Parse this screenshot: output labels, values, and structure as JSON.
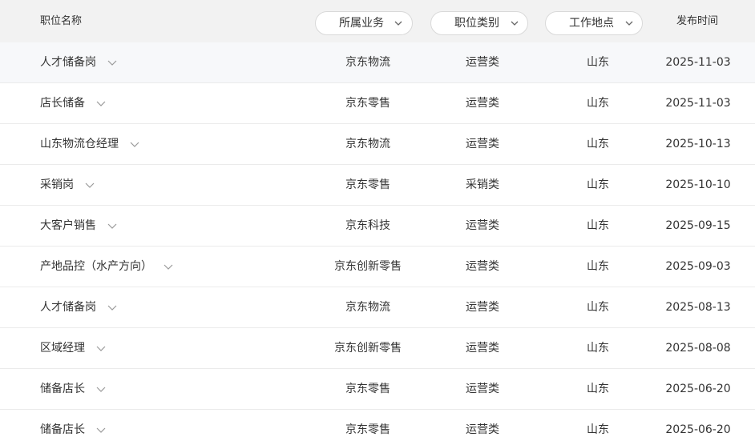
{
  "header": {
    "col_title": "职位名称",
    "filters": [
      {
        "label": "所属业务",
        "icon": "chevron-down-icon"
      },
      {
        "label": "职位类别",
        "icon": "chevron-down-icon"
      },
      {
        "label": "工作地点",
        "icon": "chevron-down-icon"
      }
    ],
    "col_date": "发布时间"
  },
  "rows": [
    {
      "title": "人才储备岗",
      "business": "京东物流",
      "category": "运营类",
      "location": "山东",
      "date": "2025-11-03",
      "highlighted": true
    },
    {
      "title": "店长储备",
      "business": "京东零售",
      "category": "运营类",
      "location": "山东",
      "date": "2025-11-03"
    },
    {
      "title": "山东物流仓经理",
      "business": "京东物流",
      "category": "运营类",
      "location": "山东",
      "date": "2025-10-13"
    },
    {
      "title": "采销岗",
      "business": "京东零售",
      "category": "采销类",
      "location": "山东",
      "date": "2025-10-10"
    },
    {
      "title": "大客户销售",
      "business": "京东科技",
      "category": "运营类",
      "location": "山东",
      "date": "2025-09-15"
    },
    {
      "title": "产地品控（水产方向）",
      "business": "京东创新零售",
      "category": "运营类",
      "location": "山东",
      "date": "2025-09-03"
    },
    {
      "title": "人才储备岗",
      "business": "京东物流",
      "category": "运营类",
      "location": "山东",
      "date": "2025-08-13"
    },
    {
      "title": "区域经理",
      "business": "京东创新零售",
      "category": "运营类",
      "location": "山东",
      "date": "2025-08-08"
    },
    {
      "title": "储备店长",
      "business": "京东零售",
      "category": "运营类",
      "location": "山东",
      "date": "2025-06-20"
    },
    {
      "title": "储备店长",
      "business": "京东零售",
      "category": "运营类",
      "location": "山东",
      "date": "2025-06-20"
    }
  ]
}
